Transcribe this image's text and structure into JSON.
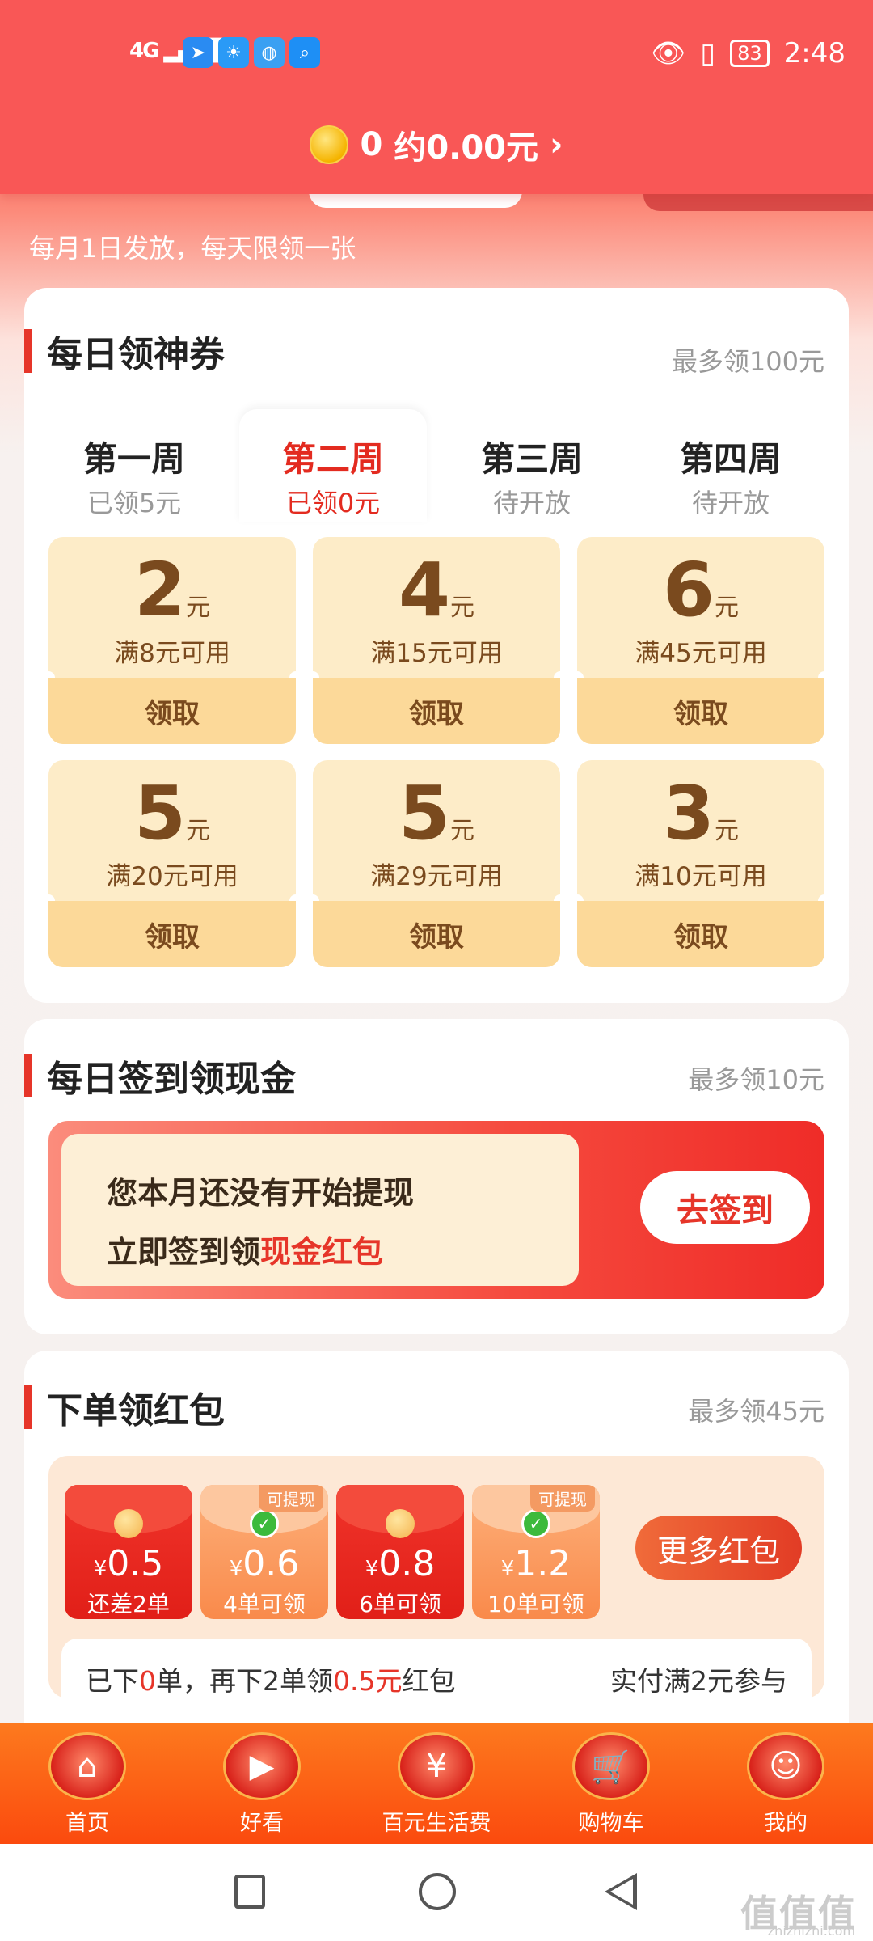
{
  "status_bar": {
    "network": "4G",
    "battery": "83",
    "time": "2:48"
  },
  "header": {
    "coin_count": "0",
    "coin_value": "约0.00元",
    "chevron": "›"
  },
  "hero": {
    "subtitle": "每月1日发放，每天限领一张"
  },
  "coupons_section": {
    "title": "每日领神券",
    "note": "最多领100元",
    "weeks": [
      {
        "title": "第一周",
        "status": "已领5元"
      },
      {
        "title": "第二周",
        "status": "已领0元"
      },
      {
        "title": "第三周",
        "status": "待开放"
      },
      {
        "title": "第四周",
        "status": "待开放"
      }
    ],
    "active_week_index": 1,
    "coupons": [
      {
        "amount": "2",
        "unit": "元",
        "condition": "满8元可用",
        "button": "领取"
      },
      {
        "amount": "4",
        "unit": "元",
        "condition": "满15元可用",
        "button": "领取"
      },
      {
        "amount": "6",
        "unit": "元",
        "condition": "满45元可用",
        "button": "领取"
      },
      {
        "amount": "5",
        "unit": "元",
        "condition": "满20元可用",
        "button": "领取"
      },
      {
        "amount": "5",
        "unit": "元",
        "condition": "满29元可用",
        "button": "领取"
      },
      {
        "amount": "3",
        "unit": "元",
        "condition": "满10元可用",
        "button": "领取"
      }
    ]
  },
  "signin_section": {
    "title": "每日签到领现金",
    "note": "最多领10元",
    "line1": "您本月还没有开始提现",
    "line2_prefix": "立即签到领",
    "line2_highlight": "现金红包",
    "button": "去签到"
  },
  "order_section": {
    "title": "下单领红包",
    "note": "最多领45元",
    "packets": [
      {
        "currency": "¥",
        "value": "0.5",
        "label": "还差2单",
        "style": "red",
        "tag": ""
      },
      {
        "currency": "¥",
        "value": "0.6",
        "label": "4单可领",
        "style": "orange",
        "tag": "可提现"
      },
      {
        "currency": "¥",
        "value": "0.8",
        "label": "6单可领",
        "style": "red",
        "tag": ""
      },
      {
        "currency": "¥",
        "value": "1.2",
        "label": "10单可领",
        "style": "orange",
        "tag": "可提现"
      }
    ],
    "more_button": "更多红包",
    "progress_prefix": "已下",
    "progress_count": "0",
    "progress_mid": "单，再下2单领",
    "progress_amount": "0.5元",
    "progress_suffix": "红包",
    "progress_right": "实付满2元参与"
  },
  "bottom_nav": [
    {
      "label": "首页",
      "icon": "home-icon",
      "glyph": "⌂"
    },
    {
      "label": "好看",
      "icon": "video-icon",
      "glyph": "▶"
    },
    {
      "label": "百元生活费",
      "icon": "yuan-icon",
      "glyph": "¥"
    },
    {
      "label": "购物车",
      "icon": "cart-icon",
      "glyph": "🛒"
    },
    {
      "label": "我的",
      "icon": "profile-icon",
      "glyph": "☺"
    }
  ],
  "watermark": {
    "text": "值值值",
    "site": "zhizhizhi.com"
  },
  "colors": {
    "brand_red": "#f95756",
    "accent_red": "#e63529",
    "coupon_bg": "#fdecc8",
    "coupon_button": "#fcd999",
    "nav_orange": "#fb4a0e"
  }
}
